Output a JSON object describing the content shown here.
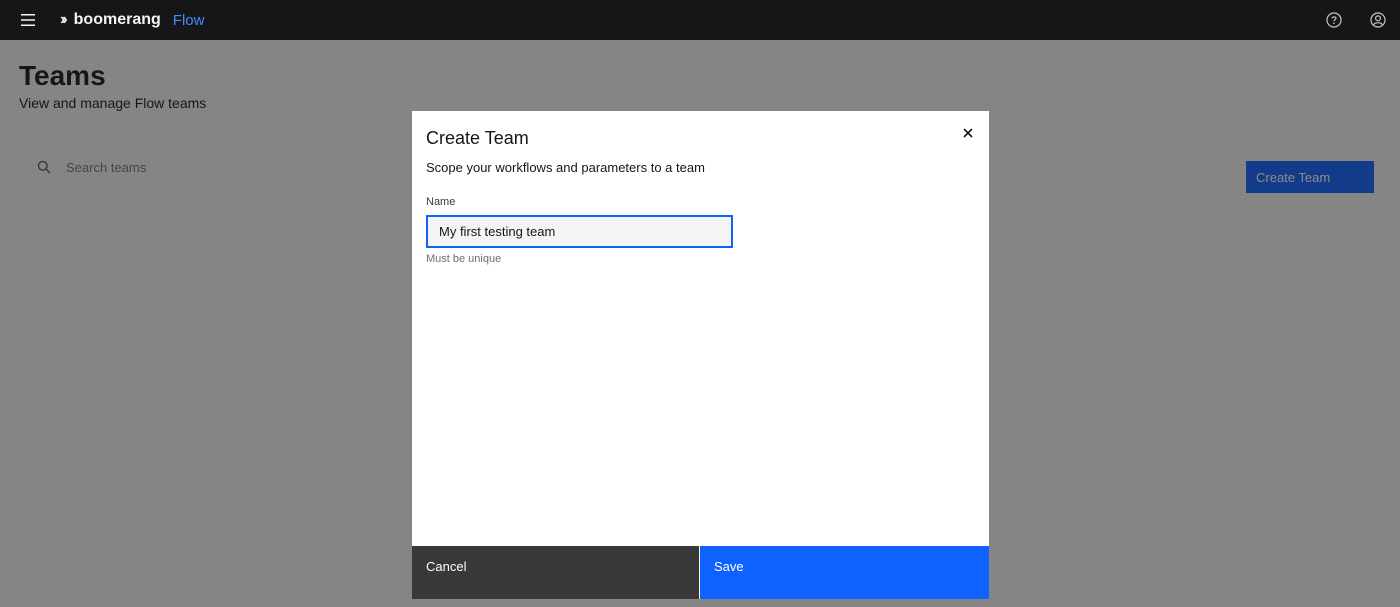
{
  "header": {
    "brand_name": "boomerang",
    "brand_product": "Flow",
    "menu_icon": "hamburger-menu-icon",
    "help_icon": "help-icon",
    "user_icon": "user-avatar-icon"
  },
  "page": {
    "title": "Teams",
    "subtitle": "View and manage Flow teams",
    "search_placeholder": "Search teams",
    "create_button": "Create Team"
  },
  "modal": {
    "title": "Create Team",
    "description": "Scope your workflows and parameters to a team",
    "field_label": "Name",
    "field_value": "My first testing team",
    "field_helper": "Must be unique",
    "cancel_label": "Cancel",
    "save_label": "Save"
  },
  "colors": {
    "header_bg": "#161616",
    "primary": "#0f62fe",
    "secondary_button": "#393939",
    "brand_accent": "#4589ff"
  }
}
